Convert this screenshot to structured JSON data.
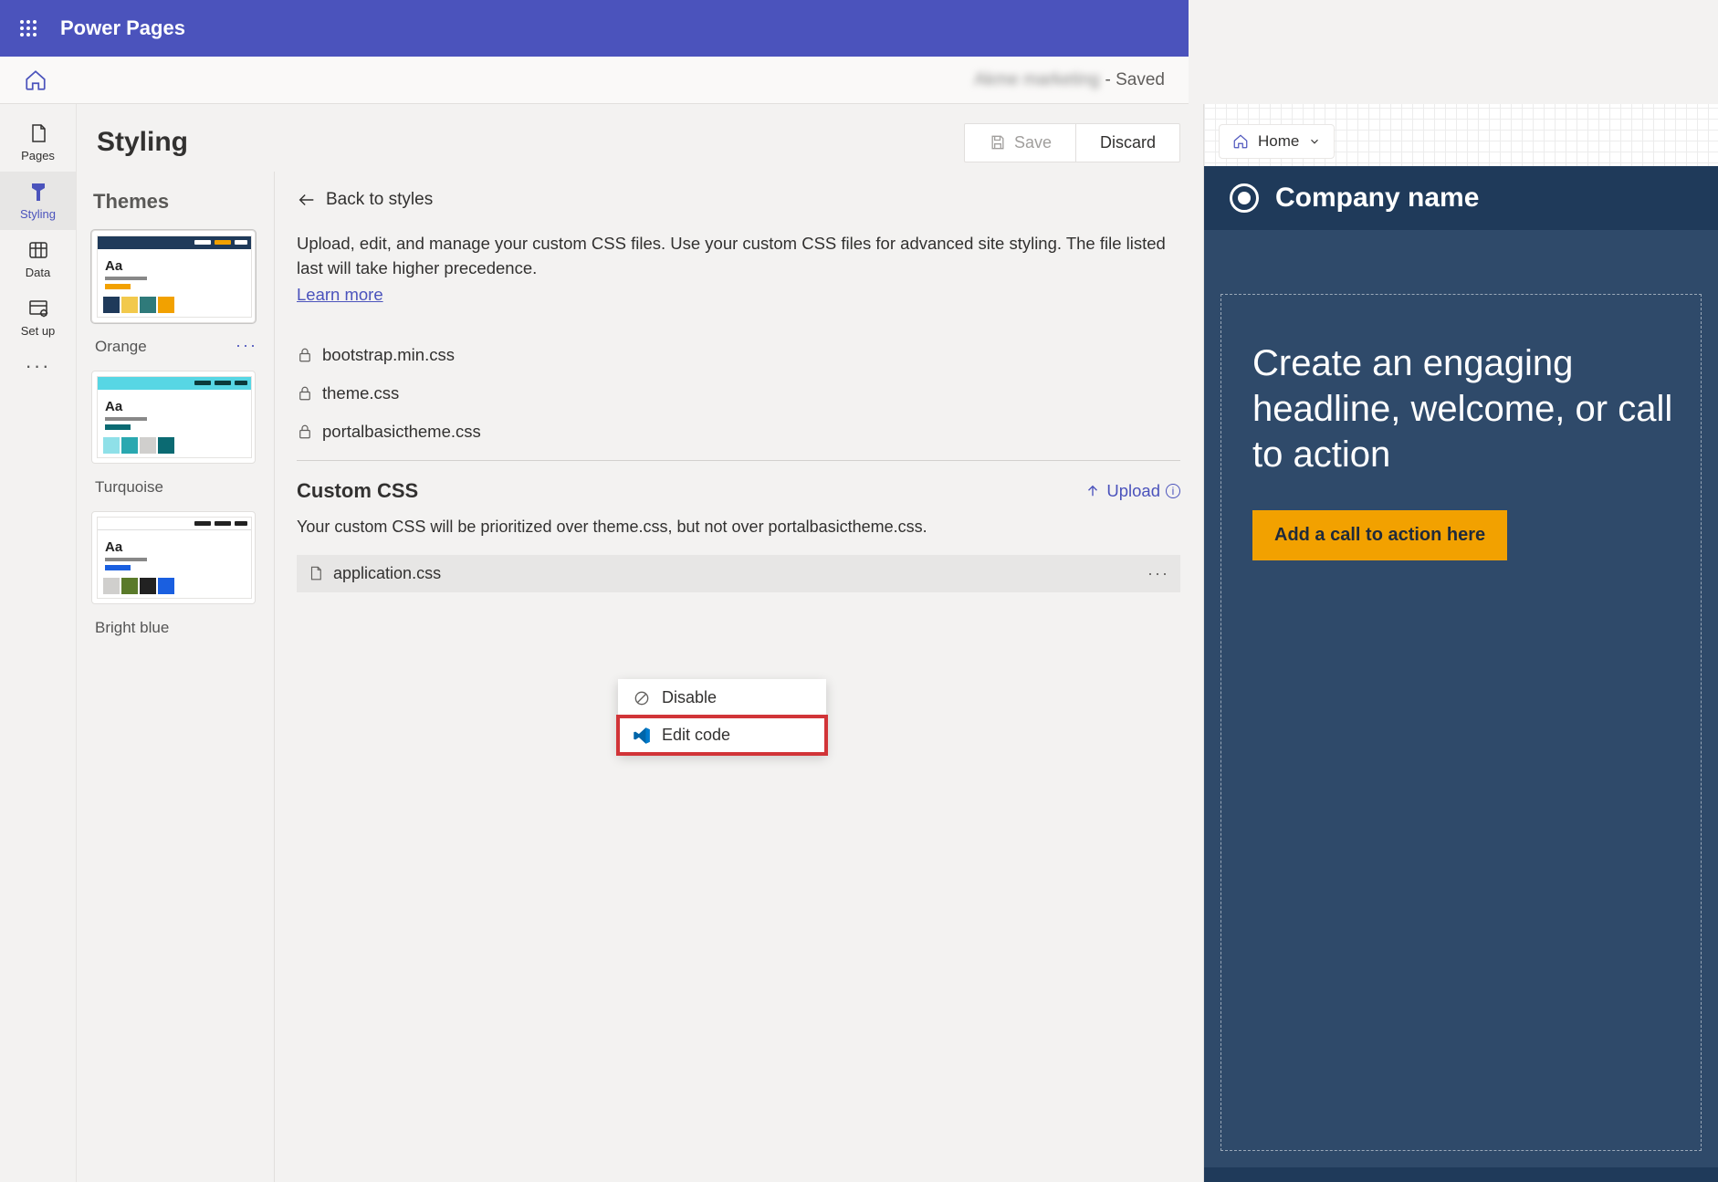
{
  "app": {
    "title": "Power Pages"
  },
  "secbar": {
    "siteName": "Akme marketing",
    "status": "- Saved"
  },
  "rail": {
    "items": [
      {
        "label": "Pages"
      },
      {
        "label": "Styling"
      },
      {
        "label": "Data"
      },
      {
        "label": "Set up"
      }
    ]
  },
  "styling": {
    "title": "Styling",
    "save": "Save",
    "discard": "Discard"
  },
  "themes": {
    "heading": "Themes",
    "items": [
      {
        "label": "Orange"
      },
      {
        "label": "Turquoise"
      },
      {
        "label": "Bright blue"
      }
    ]
  },
  "detail": {
    "back": "Back to styles",
    "desc": "Upload, edit, and manage your custom CSS files. Use your custom CSS files for advanced site styling. The file listed last will take higher precedence.",
    "learn": "Learn more",
    "files": [
      "bootstrap.min.css",
      "theme.css",
      "portalbasictheme.css"
    ],
    "custom": {
      "title": "Custom CSS",
      "upload": "Upload",
      "desc": "Your custom CSS will be prioritized over theme.css, but not over portalbasictheme.css.",
      "file": "application.css"
    }
  },
  "ctx": {
    "disable": "Disable",
    "edit": "Edit code"
  },
  "preview": {
    "crumb": "Home",
    "company": "Company name",
    "headline": "Create an engaging headline, welcome, or call to action",
    "cta": "Add a call to action here"
  }
}
